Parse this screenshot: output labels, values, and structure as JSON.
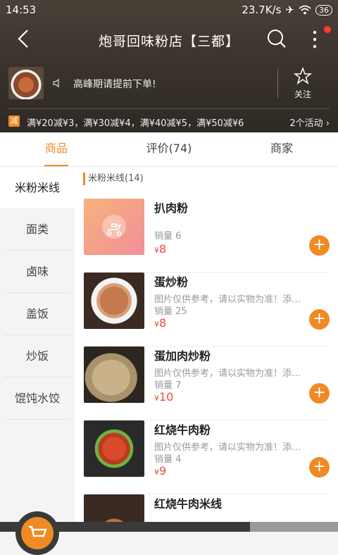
{
  "status": {
    "time": "14:53",
    "speed": "23.7K/s",
    "battery": "36"
  },
  "header": {
    "title": "炮哥回味粉店【三都】",
    "notice": "高峰期请提前下单!",
    "follow_label": "关注",
    "promo_badge": "减",
    "promo_text": "满¥20减¥3，满¥30减¥4，满¥40减¥5，满¥50减¥6",
    "promo_count": "2个活动"
  },
  "tabs": [
    "商品",
    "评价(74)",
    "商家"
  ],
  "categories": [
    "米粉米线",
    "面类",
    "卤味",
    "盖饭",
    "炒饭",
    "馄饨水饺"
  ],
  "section_title": "米粉米线(14)",
  "items": [
    {
      "name": "扒肉粉",
      "desc": "",
      "sales": "销量 6",
      "price": "8"
    },
    {
      "name": "蛋炒粉",
      "desc": "图片仅供参考，请以实物为准！添加/减...",
      "sales": "销量 25",
      "price": "8"
    },
    {
      "name": "蛋加肉炒粉",
      "desc": "图片仅供参考，请以实物为准！添加/减...",
      "sales": "销量 7",
      "price": "10"
    },
    {
      "name": "红烧牛肉粉",
      "desc": "图片仅供参考，请以实物为准！添加/减...",
      "sales": "销量 4",
      "price": "9"
    },
    {
      "name": "红烧牛肉米线",
      "desc": "",
      "sales": "",
      "price": ""
    }
  ],
  "currency": "¥",
  "colors": {
    "accent": "#f08a24",
    "price": "#e74c3c"
  }
}
